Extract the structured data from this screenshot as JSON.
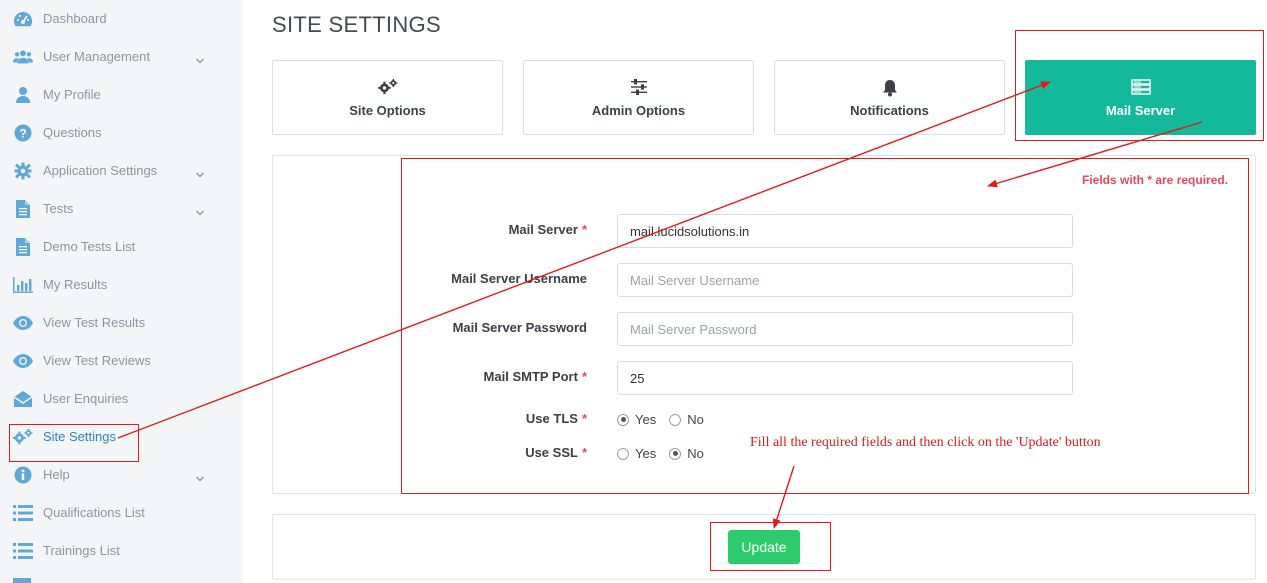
{
  "sidebar": {
    "items": [
      {
        "label": "Dashboard",
        "icon": "dashboard-icon",
        "expandable": false,
        "active": false
      },
      {
        "label": "User Management",
        "icon": "users-icon",
        "expandable": true,
        "active": false
      },
      {
        "label": "My Profile",
        "icon": "user-icon",
        "expandable": false,
        "active": false
      },
      {
        "label": "Questions",
        "icon": "question-icon",
        "expandable": false,
        "active": false
      },
      {
        "label": "Application Settings",
        "icon": "gear-icon",
        "expandable": true,
        "active": false
      },
      {
        "label": "Tests",
        "icon": "document-icon",
        "expandable": true,
        "active": false
      },
      {
        "label": "Demo Tests List",
        "icon": "document-icon",
        "expandable": false,
        "active": false
      },
      {
        "label": "My Results",
        "icon": "bar-chart-icon",
        "expandable": false,
        "active": false
      },
      {
        "label": "View Test Results",
        "icon": "eye-icon",
        "expandable": false,
        "active": false
      },
      {
        "label": "View Test Reviews",
        "icon": "eye-icon",
        "expandable": false,
        "active": false
      },
      {
        "label": "User Enquiries",
        "icon": "envelope-icon",
        "expandable": false,
        "active": false
      },
      {
        "label": "Site Settings",
        "icon": "gears-icon",
        "expandable": false,
        "active": true
      },
      {
        "label": "Help",
        "icon": "info-icon",
        "expandable": true,
        "active": false
      },
      {
        "label": "Qualifications List",
        "icon": "list-icon",
        "expandable": false,
        "active": false
      },
      {
        "label": "Trainings List",
        "icon": "list-icon",
        "expandable": false,
        "active": false
      }
    ]
  },
  "page": {
    "title": "SITE SETTINGS"
  },
  "tabs": [
    {
      "label": "Site Options",
      "icon": "gears-icon",
      "active": false
    },
    {
      "label": "Admin Options",
      "icon": "sliders-icon",
      "active": false
    },
    {
      "label": "Notifications",
      "icon": "bell-icon",
      "active": false
    },
    {
      "label": "Mail Server",
      "icon": "server-icon",
      "active": true
    }
  ],
  "form": {
    "required_note": "Fields with * are required.",
    "required_mark": "*",
    "mail_server": {
      "label": "Mail Server",
      "value": "mail.lucidsolutions.in",
      "placeholder": "Mail Server"
    },
    "username": {
      "label": "Mail Server Username",
      "value": "",
      "placeholder": "Mail Server Username"
    },
    "password": {
      "label": "Mail Server Password",
      "value": "",
      "placeholder": "Mail Server Password"
    },
    "smtp_port": {
      "label": "Mail SMTP Port",
      "value": "25",
      "placeholder": "Mail SMTP Port"
    },
    "use_tls": {
      "label": "Use TLS",
      "yes": "Yes",
      "no": "No",
      "selected": "Yes"
    },
    "use_ssl": {
      "label": "Use SSL",
      "yes": "Yes",
      "no": "No",
      "selected": "No"
    }
  },
  "actions": {
    "update_label": "Update"
  },
  "annotation": {
    "instruction": "Fill all the required fields and then click on the 'Update' button",
    "color": "#e11b1b"
  },
  "colors": {
    "accent": "#13b99a",
    "update_button": "#2ecb6c",
    "sidebar_icon": "#5fa8d8",
    "active_link": "#2e82c5",
    "required": "#e8495a"
  }
}
